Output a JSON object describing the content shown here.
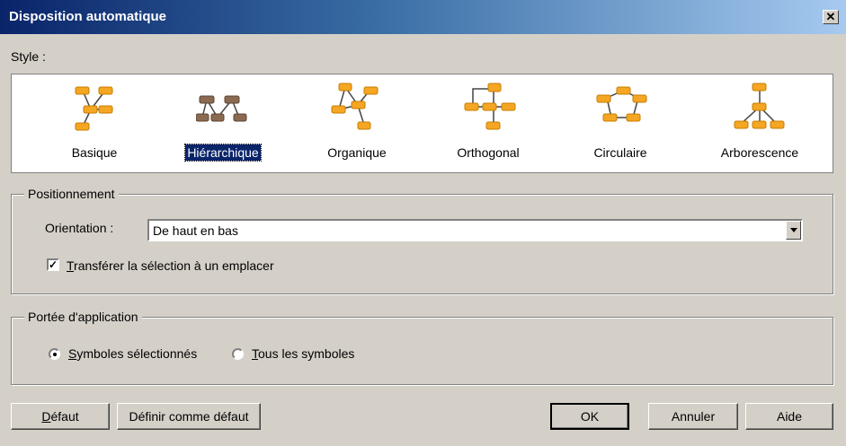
{
  "window": {
    "title": "Disposition automatique"
  },
  "style": {
    "label": "Style :",
    "items": [
      {
        "name": "Basique",
        "selected": false,
        "icon": "basic-layout-icon"
      },
      {
        "name": "Hiérarchique",
        "selected": true,
        "icon": "hierarchical-layout-icon"
      },
      {
        "name": "Organique",
        "selected": false,
        "icon": "organic-layout-icon"
      },
      {
        "name": "Orthogonal",
        "selected": false,
        "icon": "orthogonal-layout-icon"
      },
      {
        "name": "Circulaire",
        "selected": false,
        "icon": "circular-layout-icon"
      },
      {
        "name": "Arborescence",
        "selected": false,
        "icon": "tree-layout-icon"
      }
    ]
  },
  "positioning": {
    "title": "Positionnement",
    "orientation_label": "Orientation :",
    "orientation_value": "De haut en bas",
    "transfer_checkbox": {
      "checked": true,
      "first": "T",
      "rest": "ransférer la sélection à un emplacer"
    }
  },
  "scope": {
    "title": "Portée d'application",
    "selected_symbols": {
      "first": "S",
      "rest": "ymboles sélectionnés",
      "checked": true
    },
    "all_symbols": {
      "first": "T",
      "rest": "ous les symboles",
      "checked": false
    }
  },
  "buttons": {
    "default": {
      "first": "D",
      "rest": "éfaut"
    },
    "set_default": "Définir comme défaut",
    "ok": "OK",
    "cancel": "Annuler",
    "help": "Aide"
  },
  "colors": {
    "node_orange": "#f5a623",
    "node_brown": "#8b6a52",
    "selection": "#0a246a"
  }
}
